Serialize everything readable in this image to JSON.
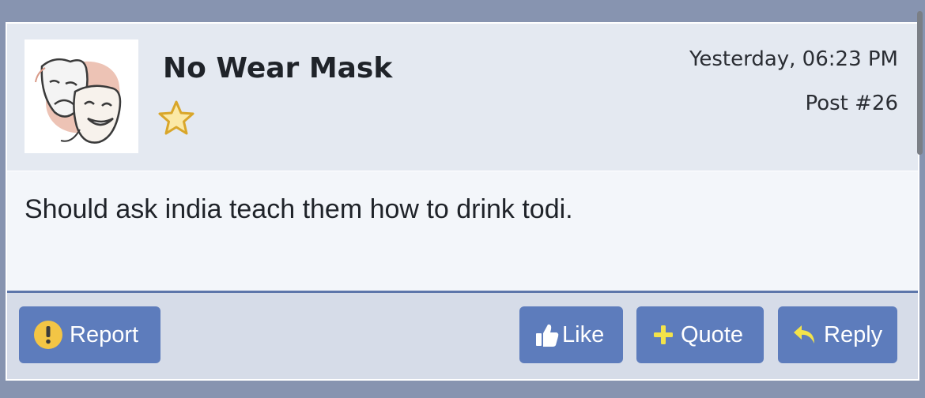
{
  "post": {
    "username": "No Wear Mask",
    "rank_icon": "star-icon",
    "avatar_icon": "theater-masks-icon",
    "date": "Yesterday, 06:23 PM",
    "post_number": "Post #26",
    "message": "Should ask india teach them how to drink todi."
  },
  "actions": {
    "report": {
      "label": "Report",
      "icon": "exclamation-circle-icon"
    },
    "like": {
      "label": "Like",
      "icon": "thumbs-up-icon"
    },
    "quote": {
      "label": "Quote",
      "icon": "plus-icon"
    },
    "reply": {
      "label": "Reply",
      "icon": "reply-arrow-icon"
    }
  },
  "colors": {
    "page_band": "#8794b0",
    "header_bg": "#e4e9f1",
    "body_bg": "#f3f6fa",
    "footer_bg": "#d6dce8",
    "button": "#5d7cbc",
    "accent_yellow": "#f3c545"
  }
}
